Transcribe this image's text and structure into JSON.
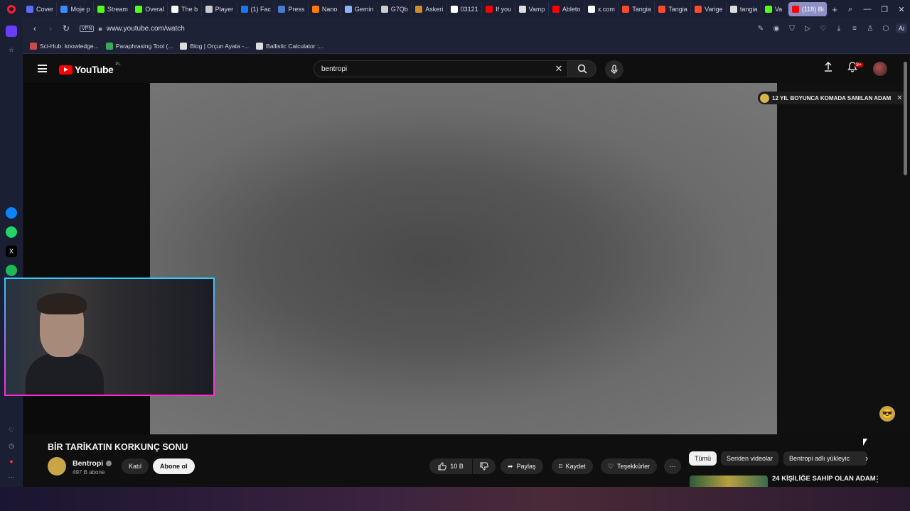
{
  "browser": {
    "tabs": [
      {
        "label": "Cover",
        "color": "#5a6cff"
      },
      {
        "label": "Moje p",
        "color": "#3a8bff"
      },
      {
        "label": "Stream",
        "color": "#53fc18"
      },
      {
        "label": "Overal",
        "color": "#53fc18"
      },
      {
        "label": "The b",
        "color": "#ffffff"
      },
      {
        "label": "Player",
        "color": "#cccccc"
      },
      {
        "label": "(1) Fac",
        "color": "#1877f2"
      },
      {
        "label": "Press",
        "color": "#4a7bd0"
      },
      {
        "label": "Nano",
        "color": "#ff7a00"
      },
      {
        "label": "Gemin",
        "color": "#8ab4f8"
      },
      {
        "label": "G7Qb",
        "color": "#cccccc"
      },
      {
        "label": "Askeri",
        "color": "#d08a30"
      },
      {
        "label": "03121",
        "color": "#ffffff"
      },
      {
        "label": "If you",
        "color": "#ff0000"
      },
      {
        "label": "Vamp",
        "color": "#dddddd"
      },
      {
        "label": "Ableto",
        "color": "#ff0000"
      },
      {
        "label": "x.com",
        "color": "#ffffff"
      },
      {
        "label": "Tangia",
        "color": "#ff4a2a"
      },
      {
        "label": "Tangia",
        "color": "#ff4a2a"
      },
      {
        "label": "Varige",
        "color": "#ff4a2a"
      },
      {
        "label": "tangia",
        "color": "#dddddd"
      },
      {
        "label": "Va",
        "color": "#53fc18"
      },
      {
        "label": "(118) Bi",
        "color": "#ff0000"
      }
    ],
    "address": {
      "vpn": "VPN",
      "url": "www.youtube.com/watch",
      "ai_label": "Ai"
    },
    "bookmarks": [
      {
        "label": "Sci-Hub: knowledge...",
        "color": "#c94a4a"
      },
      {
        "label": "Paraphrasing Tool (...",
        "color": "#3aa85a"
      },
      {
        "label": "Blog | Orçun Ayata -...",
        "color": "#dddddd"
      },
      {
        "label": "Ballistic Calculator :...",
        "color": "#dddddd"
      }
    ]
  },
  "youtube": {
    "logo_text": "YouTube",
    "country_code": "PL",
    "search": {
      "query": "bentropi"
    },
    "notifications_badge": "9+",
    "promo_text": "12 YIL BOYUNCA KOMADA SANILAN ADAM",
    "video": {
      "title": "BİR TARİKATIN KORKUNÇ SONU",
      "channel": "Bentropi",
      "subscribers": "497 B abone",
      "join_label": "Katıl",
      "subscribe_label": "Abone ol",
      "likes": "10 B",
      "share_label": "Paylaş",
      "save_label": "Kaydet",
      "thanks_label": "Teşekkürler"
    },
    "chips": [
      "Tümü",
      "Seriden videolar",
      "Bentropi adlı yükleyic"
    ],
    "recommendation": {
      "title": "24 KİŞİLİĞE SAHİP OLAN ADAM"
    }
  }
}
